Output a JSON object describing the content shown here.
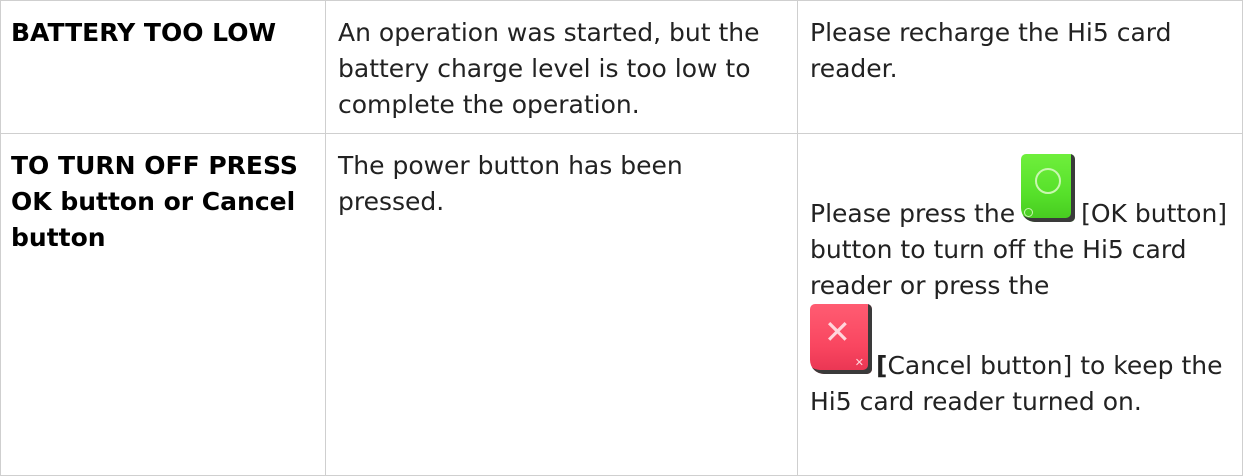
{
  "rows": [
    {
      "message": "BATTERY TOO LOW",
      "description": "An operation was started, but the battery charge level is too low to complete the operation.",
      "action": "Please recharge the Hi5 card reader."
    },
    {
      "message": "TO TURN OFF PRESS OK button or Cancel button",
      "description": "The power button has been pressed.",
      "action_part1": "Please press the",
      "action_part2": "[OK button] button to turn off the Hi5 card reader or press the",
      "action_part3_bracket": "[",
      "action_part3": "Cancel button] to keep the Hi5 card reader turned on."
    }
  ],
  "icons": {
    "ok": {
      "name": "ok-button-icon",
      "color": "#56e02a"
    },
    "cancel": {
      "name": "cancel-button-icon",
      "color": "#f94660"
    }
  }
}
